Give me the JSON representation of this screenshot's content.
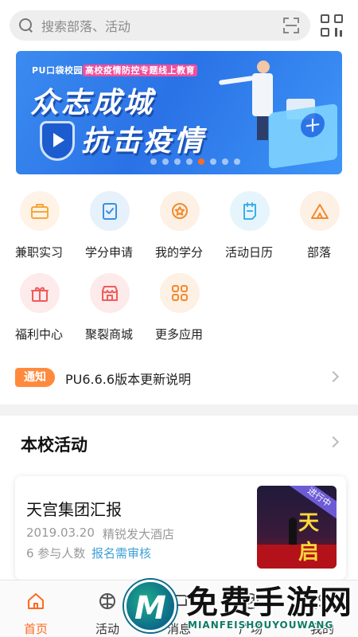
{
  "search": {
    "placeholder": "搜索部落、活动"
  },
  "banner": {
    "tagline_prefix": "PU口袋校园",
    "tagline_highlight": "高校疫情防控专题线上教育",
    "line1": "众志成城",
    "line2": "抗击疫情",
    "dot_count": 8,
    "active_dot": 5
  },
  "grid": {
    "items": [
      {
        "label": "兼职实习",
        "icon": "briefcase-icon",
        "color": "#f7a63a"
      },
      {
        "label": "学分申请",
        "icon": "checklist-icon",
        "color": "#3b8fe0"
      },
      {
        "label": "我的学分",
        "icon": "star-badge-icon",
        "color": "#f28a2e"
      },
      {
        "label": "活动日历",
        "icon": "calendar-icon",
        "color": "#3bb0e8"
      },
      {
        "label": "部落",
        "icon": "tent-icon",
        "color": "#f28a2e"
      },
      {
        "label": "福利中心",
        "icon": "gift-icon",
        "color": "#ef5b5b"
      },
      {
        "label": "聚裂商城",
        "icon": "store-icon",
        "color": "#ef5b5b"
      },
      {
        "label": "更多应用",
        "icon": "apps-grid-icon",
        "color": "#f28a2e"
      }
    ]
  },
  "notice": {
    "badge": "通知",
    "text": "PU6.6.6版本更新说明"
  },
  "section": {
    "title": "本校活动"
  },
  "activity": {
    "title": "天宫集团汇报",
    "date": "2019.03.20",
    "place": "精锐发大酒店",
    "participants": "6 参与人数",
    "status": "报名需审核",
    "ribbon": "进行中",
    "thumb_text": "天启"
  },
  "tabs": [
    {
      "label": "首页",
      "icon": "home-icon",
      "active": true
    },
    {
      "label": "活动",
      "icon": "activity-icon",
      "active": false
    },
    {
      "label": "消息",
      "icon": "message-icon",
      "active": false
    },
    {
      "label": "广场",
      "icon": "plaza-icon",
      "active": false
    },
    {
      "label": "我的",
      "icon": "profile-icon",
      "active": false
    }
  ],
  "watermark": {
    "title": "免费手游网",
    "subtitle": "MIANFEISHOUYOUWANG"
  },
  "colors": {
    "accent": "#ff6a21",
    "notice_badge": "#ff8a3d",
    "status_link": "#3fa0d6"
  }
}
